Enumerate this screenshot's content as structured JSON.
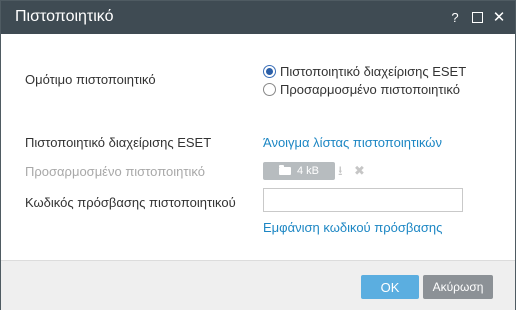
{
  "dialog": {
    "title": "Πιστοποιητικό",
    "help_label": "?"
  },
  "form": {
    "peer_cert_label": "Ομότιμο πιστοποιητικό",
    "options": [
      {
        "label": "Πιστοποιητικό διαχείρισης ESET",
        "selected": true
      },
      {
        "label": "Προσαρμοσμένο πιστοποιητικό",
        "selected": false
      }
    ],
    "eset_cert_label": "Πιστοποιητικό διαχείρισης ESET",
    "open_list_link": "Άνοιγμα λίστας πιστοποιητικών",
    "custom_cert_label": "Προσαρμοσμένο πιστοποιητικό",
    "upload_size": "4 kB",
    "password_label": "Κωδικός πρόσβασης πιστοποιητικού",
    "password_value": "",
    "show_password_link": "Εμφάνιση κωδικού πρόσβασης"
  },
  "footer": {
    "ok_label": "OK",
    "cancel_label": "Ακύρωση"
  },
  "colors": {
    "titlebar": "#3f4b53",
    "link": "#1d87c4",
    "ok_button": "#5baee0",
    "cancel_button": "#8c9196"
  }
}
